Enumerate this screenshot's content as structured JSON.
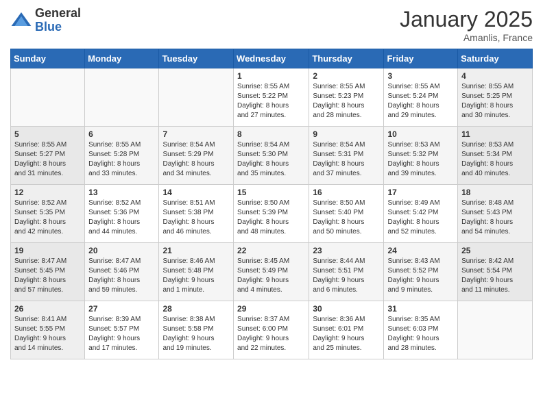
{
  "header": {
    "logo_general": "General",
    "logo_blue": "Blue",
    "month": "January 2025",
    "location": "Amanlis, France"
  },
  "days_of_week": [
    "Sunday",
    "Monday",
    "Tuesday",
    "Wednesday",
    "Thursday",
    "Friday",
    "Saturday"
  ],
  "weeks": [
    [
      {
        "day": "",
        "info": ""
      },
      {
        "day": "",
        "info": ""
      },
      {
        "day": "",
        "info": ""
      },
      {
        "day": "1",
        "info": "Sunrise: 8:55 AM\nSunset: 5:22 PM\nDaylight: 8 hours\nand 27 minutes."
      },
      {
        "day": "2",
        "info": "Sunrise: 8:55 AM\nSunset: 5:23 PM\nDaylight: 8 hours\nand 28 minutes."
      },
      {
        "day": "3",
        "info": "Sunrise: 8:55 AM\nSunset: 5:24 PM\nDaylight: 8 hours\nand 29 minutes."
      },
      {
        "day": "4",
        "info": "Sunrise: 8:55 AM\nSunset: 5:25 PM\nDaylight: 8 hours\nand 30 minutes."
      }
    ],
    [
      {
        "day": "5",
        "info": "Sunrise: 8:55 AM\nSunset: 5:27 PM\nDaylight: 8 hours\nand 31 minutes."
      },
      {
        "day": "6",
        "info": "Sunrise: 8:55 AM\nSunset: 5:28 PM\nDaylight: 8 hours\nand 33 minutes."
      },
      {
        "day": "7",
        "info": "Sunrise: 8:54 AM\nSunset: 5:29 PM\nDaylight: 8 hours\nand 34 minutes."
      },
      {
        "day": "8",
        "info": "Sunrise: 8:54 AM\nSunset: 5:30 PM\nDaylight: 8 hours\nand 35 minutes."
      },
      {
        "day": "9",
        "info": "Sunrise: 8:54 AM\nSunset: 5:31 PM\nDaylight: 8 hours\nand 37 minutes."
      },
      {
        "day": "10",
        "info": "Sunrise: 8:53 AM\nSunset: 5:32 PM\nDaylight: 8 hours\nand 39 minutes."
      },
      {
        "day": "11",
        "info": "Sunrise: 8:53 AM\nSunset: 5:34 PM\nDaylight: 8 hours\nand 40 minutes."
      }
    ],
    [
      {
        "day": "12",
        "info": "Sunrise: 8:52 AM\nSunset: 5:35 PM\nDaylight: 8 hours\nand 42 minutes."
      },
      {
        "day": "13",
        "info": "Sunrise: 8:52 AM\nSunset: 5:36 PM\nDaylight: 8 hours\nand 44 minutes."
      },
      {
        "day": "14",
        "info": "Sunrise: 8:51 AM\nSunset: 5:38 PM\nDaylight: 8 hours\nand 46 minutes."
      },
      {
        "day": "15",
        "info": "Sunrise: 8:50 AM\nSunset: 5:39 PM\nDaylight: 8 hours\nand 48 minutes."
      },
      {
        "day": "16",
        "info": "Sunrise: 8:50 AM\nSunset: 5:40 PM\nDaylight: 8 hours\nand 50 minutes."
      },
      {
        "day": "17",
        "info": "Sunrise: 8:49 AM\nSunset: 5:42 PM\nDaylight: 8 hours\nand 52 minutes."
      },
      {
        "day": "18",
        "info": "Sunrise: 8:48 AM\nSunset: 5:43 PM\nDaylight: 8 hours\nand 54 minutes."
      }
    ],
    [
      {
        "day": "19",
        "info": "Sunrise: 8:47 AM\nSunset: 5:45 PM\nDaylight: 8 hours\nand 57 minutes."
      },
      {
        "day": "20",
        "info": "Sunrise: 8:47 AM\nSunset: 5:46 PM\nDaylight: 8 hours\nand 59 minutes."
      },
      {
        "day": "21",
        "info": "Sunrise: 8:46 AM\nSunset: 5:48 PM\nDaylight: 9 hours\nand 1 minute."
      },
      {
        "day": "22",
        "info": "Sunrise: 8:45 AM\nSunset: 5:49 PM\nDaylight: 9 hours\nand 4 minutes."
      },
      {
        "day": "23",
        "info": "Sunrise: 8:44 AM\nSunset: 5:51 PM\nDaylight: 9 hours\nand 6 minutes."
      },
      {
        "day": "24",
        "info": "Sunrise: 8:43 AM\nSunset: 5:52 PM\nDaylight: 9 hours\nand 9 minutes."
      },
      {
        "day": "25",
        "info": "Sunrise: 8:42 AM\nSunset: 5:54 PM\nDaylight: 9 hours\nand 11 minutes."
      }
    ],
    [
      {
        "day": "26",
        "info": "Sunrise: 8:41 AM\nSunset: 5:55 PM\nDaylight: 9 hours\nand 14 minutes."
      },
      {
        "day": "27",
        "info": "Sunrise: 8:39 AM\nSunset: 5:57 PM\nDaylight: 9 hours\nand 17 minutes."
      },
      {
        "day": "28",
        "info": "Sunrise: 8:38 AM\nSunset: 5:58 PM\nDaylight: 9 hours\nand 19 minutes."
      },
      {
        "day": "29",
        "info": "Sunrise: 8:37 AM\nSunset: 6:00 PM\nDaylight: 9 hours\nand 22 minutes."
      },
      {
        "day": "30",
        "info": "Sunrise: 8:36 AM\nSunset: 6:01 PM\nDaylight: 9 hours\nand 25 minutes."
      },
      {
        "day": "31",
        "info": "Sunrise: 8:35 AM\nSunset: 6:03 PM\nDaylight: 9 hours\nand 28 minutes."
      },
      {
        "day": "",
        "info": ""
      }
    ]
  ]
}
